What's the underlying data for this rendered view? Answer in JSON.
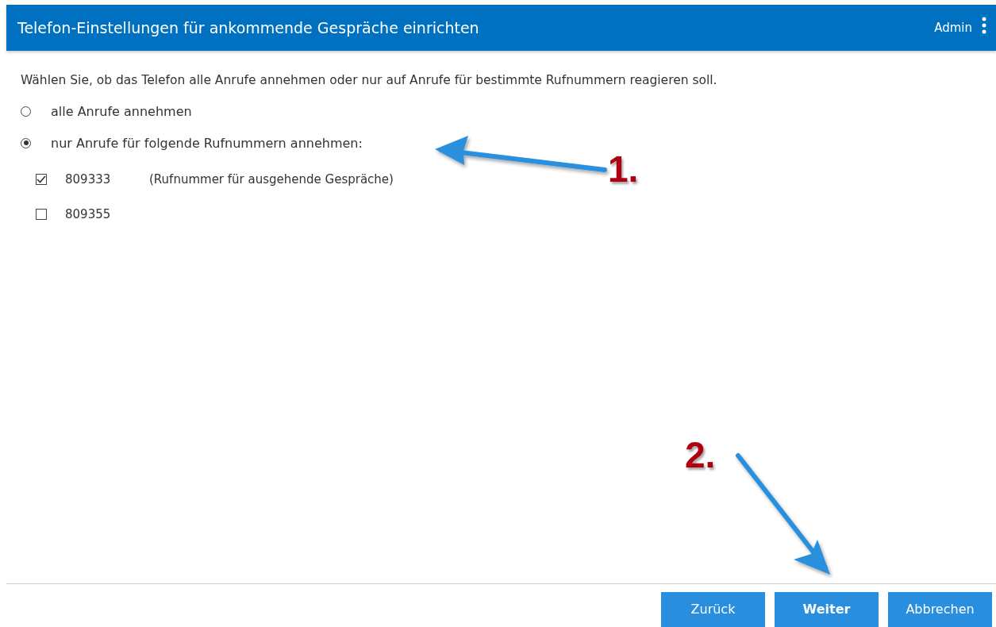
{
  "header": {
    "title": "Telefon-Einstellungen für ankommende Gespräche einrichten",
    "user": "Admin"
  },
  "intro": "Wählen Sie, ob das Telefon alle Anrufe annehmen oder nur auf Anrufe für bestimmte Rufnummern reagieren soll.",
  "options": [
    {
      "label": "alle Anrufe annehmen",
      "selected": false
    },
    {
      "label": "nur Anrufe für folgende Rufnummern annehmen:",
      "selected": true
    }
  ],
  "numbers": [
    {
      "number": "809333",
      "note": "(Rufnummer für ausgehende Gespräche)",
      "checked": true
    },
    {
      "number": "809355",
      "checked": false
    }
  ],
  "buttons": [
    {
      "label": "Zurück",
      "primary": false
    },
    {
      "label": "Weiter",
      "primary": true
    },
    {
      "label": "Abbrechen",
      "primary": false
    }
  ],
  "annotations": [
    {
      "label": "1."
    },
    {
      "label": "2."
    }
  ]
}
